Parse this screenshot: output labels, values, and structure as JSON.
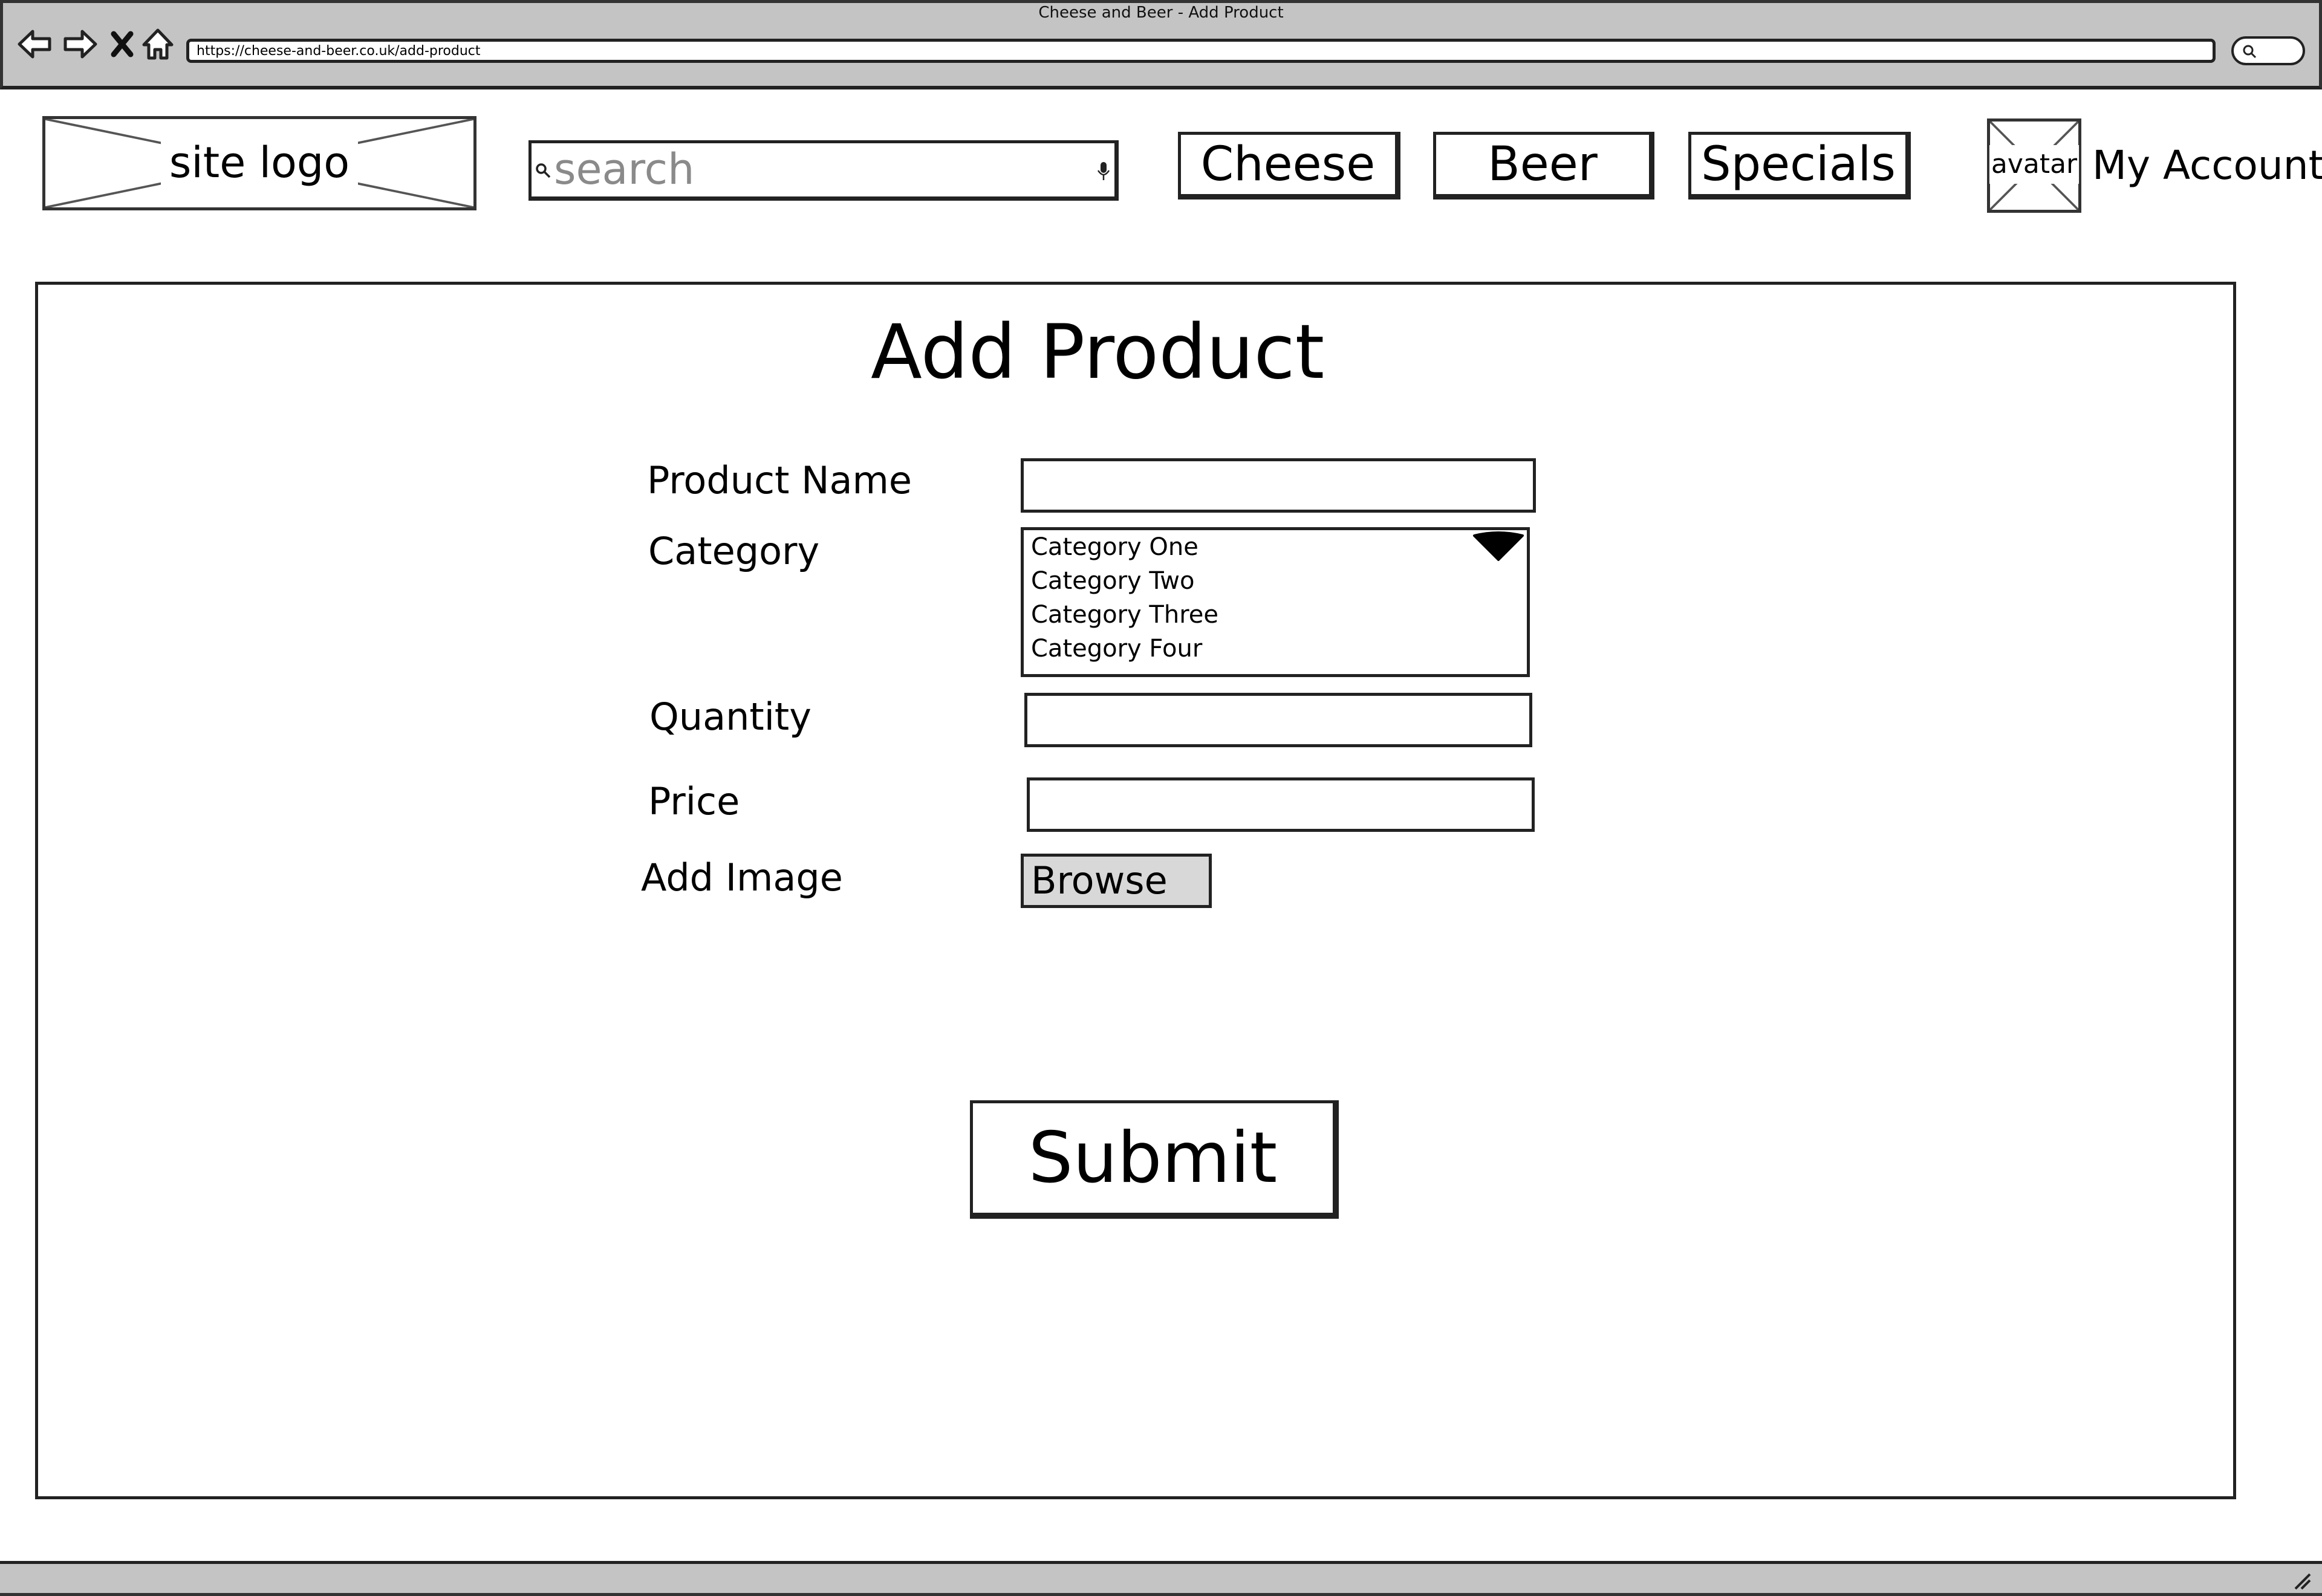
{
  "window": {
    "title": "Cheese and Beer - Add Product",
    "url": "https://cheese-and-beer.co.uk/add-product"
  },
  "toolbar": {
    "icons": [
      "back-arrow-icon",
      "forward-arrow-icon",
      "close-x-icon",
      "home-icon",
      "search-icon"
    ]
  },
  "header": {
    "logo_label": "site logo",
    "search": {
      "placeholder": "search",
      "value": ""
    },
    "nav": {
      "cheese": "Cheese",
      "beer": "Beer",
      "specials": "Specials"
    },
    "avatar_label": "avatar",
    "account_label": "My Account"
  },
  "form": {
    "title": "Add Product",
    "product_name": {
      "label": "Product Name",
      "value": ""
    },
    "category": {
      "label": "Category",
      "options": [
        "Category One",
        "Category Two",
        "Category Three",
        "Category Four"
      ]
    },
    "quantity": {
      "label": "Quantity",
      "value": ""
    },
    "price": {
      "label": "Price",
      "value": ""
    },
    "image": {
      "label": "Add Image",
      "browse_label": "Browse"
    },
    "submit_label": "Submit"
  },
  "colors": {
    "chrome": "#c4c4c4",
    "ink": "#222222",
    "button_gray": "#d8d8d8"
  }
}
